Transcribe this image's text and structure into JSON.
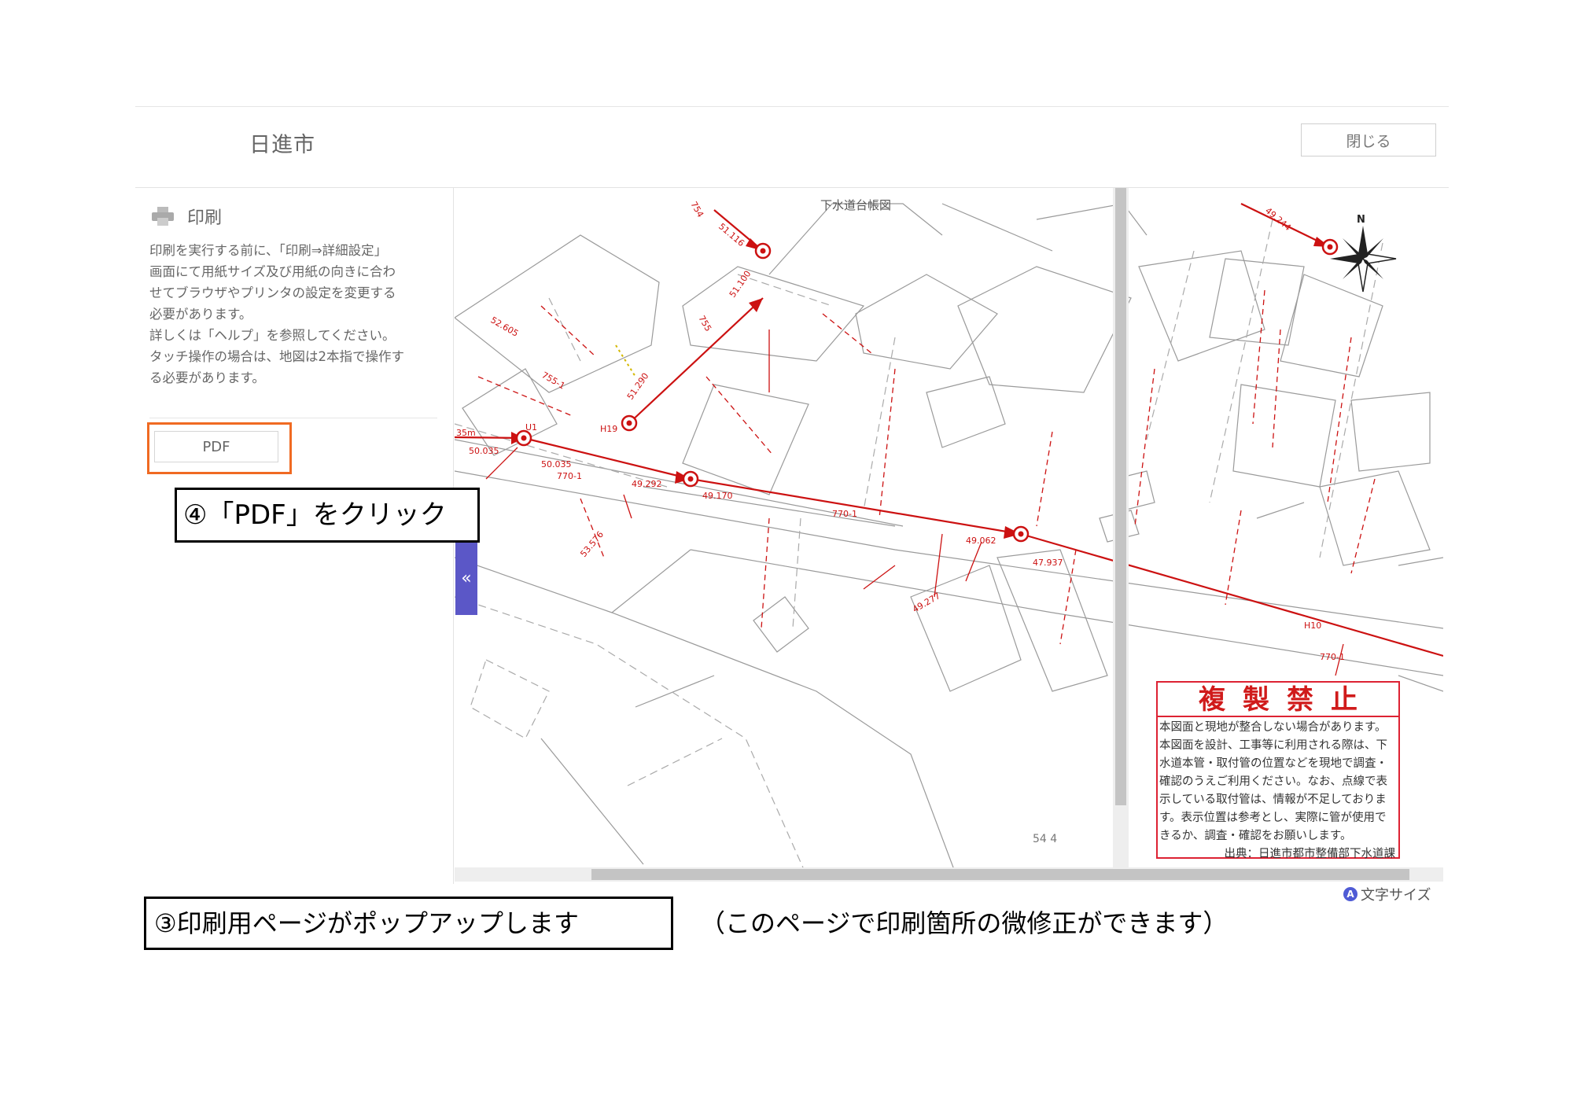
{
  "header": {
    "title": "日進市",
    "close_label": "閉じる"
  },
  "sidebar": {
    "print_label": "印刷",
    "description": "印刷を実行する前に、「印刷⇒詳細設定」\n画面にて用紙サイズ及び用紙の向きに合わ\nせてブラウザやプリンタの設定を変更する\n必要があります。\n詳しくは「ヘルプ」を参照してください。\nタッチ操作の場合は、地図は2本指で操作す\nる必要があります。",
    "pdf_label": "PDF",
    "collapse_label": "«"
  },
  "map": {
    "title": "下水道台帳図",
    "sheet_number": "54 4",
    "north_label": "N",
    "labels": [
      "35m",
      "50.035",
      "50.035",
      "49.292",
      "49.170",
      "49.062",
      "47.937",
      "52.605",
      "53.576",
      "51.290",
      "51.116",
      "51.100",
      "49.277",
      "49.244",
      "U1",
      "H19",
      "H10",
      "770-1",
      "770-1",
      "770-1",
      "755",
      "754",
      "755-1"
    ],
    "pipe_color": "#cc1111"
  },
  "notice": {
    "title": "複製禁止",
    "body": "本図面と現地が整合しない場合があります。\n本図面を設計、工事等に利用される際は、下\n水道本管・取付管の位置などを現地で調査・\n確認のうえご利用ください。なお、点線で表\n示している取付管は、情報が不足しておりま\nす。表示位置は参考とし、実際に管が使用で\nきるか、調査・確認をお願いします。",
    "source": "出典：日進市都市整備部下水道課"
  },
  "font_size": {
    "icon": "A",
    "label": "文字サイズ"
  },
  "annotations": {
    "step4": "④「PDF」をクリック",
    "step3": "③印刷用ページがポップアップします",
    "step3_note": "（このページで印刷箇所の微修正ができます）"
  }
}
